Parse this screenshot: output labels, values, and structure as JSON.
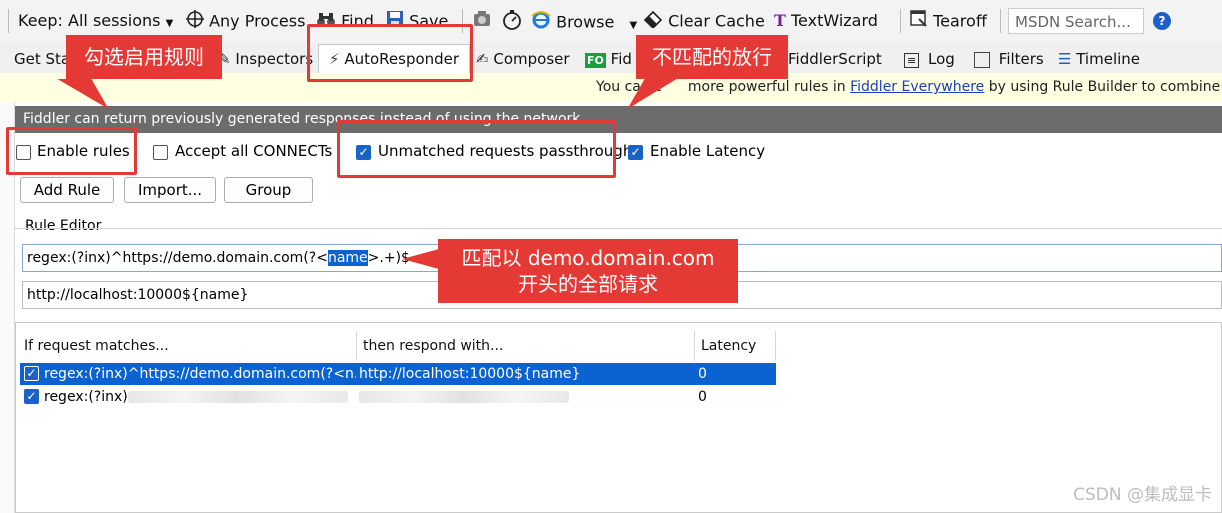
{
  "toolbar": {
    "keep": "Keep: All sessions",
    "any_process": "Any Process",
    "find": "Find",
    "save": "Save",
    "browse": "Browse",
    "clear_cache": "Clear Cache",
    "textwizard": "TextWizard",
    "tearoff": "Tearoff",
    "msdn_search": "MSDN Search...",
    "help": "?"
  },
  "tabs": {
    "get_started": "Get Star",
    "inspectors": "Inspectors",
    "autoresponder": "AutoResponder",
    "composer": "Composer",
    "fiddler_orchestra": "Fid",
    "fiddlerscript": "FiddlerScript",
    "log": "Log",
    "filters": "Filters",
    "timeline": "Timeline"
  },
  "banner": {
    "pre": "You can c",
    "mid": "more powerful rules in ",
    "link": "Fiddler Everywhere",
    "post": " by using Rule Builder to combine m"
  },
  "info_bar": "Fiddler can return previously generated responses instead of using the network.",
  "options": {
    "enable_rules": "Enable rules",
    "accept_connects": "Accept all CONNECTs",
    "unmatched_passthrough": "Unmatched requests passthrough",
    "enable_latency": "Enable Latency",
    "enable_rules_checked": false,
    "accept_connects_checked": false,
    "unmatched_passthrough_checked": true,
    "enable_latency_checked": true
  },
  "buttons": {
    "add_rule": "Add Rule",
    "import": "Import...",
    "group": "Group"
  },
  "rule_editor": {
    "label": "Rule Editor",
    "match_pre": "regex:(?inx)^https://demo.domain.com(?<",
    "match_hl": "name",
    "match_post": ">.+)$",
    "response": "http://localhost:10000${name}"
  },
  "grid": {
    "headers": [
      "If request matches...",
      "then respond with...",
      "Latency"
    ],
    "rows": [
      {
        "match": "regex:(?inx)^https://demo.domain.com(?<n...",
        "respond": "http://localhost:10000${name}",
        "latency": "0"
      },
      {
        "match": "regex:(?inx)",
        "respond": "",
        "latency": "0"
      }
    ]
  },
  "annotations": {
    "enable_rules": "勾选启用规则",
    "passthrough": "不匹配的放行",
    "match_line1": "匹配以 demo.domain.com",
    "match_line2": "开头的全部请求"
  },
  "watermark": "CSDN @集成显卡",
  "colors": {
    "annotation_red": "#e53935",
    "selection_blue": "#0a63d0",
    "checkbox_blue": "#1a63c6",
    "info_gray": "#6c6c6c",
    "banner_yellow": "#ffffe1"
  }
}
